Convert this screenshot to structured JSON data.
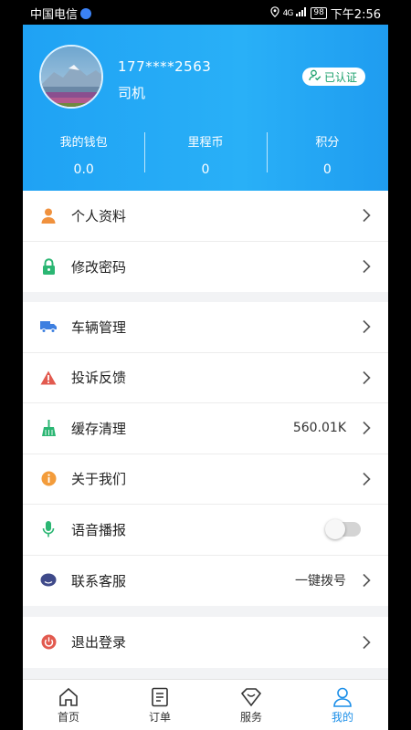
{
  "status_bar": {
    "carrier": "中国电信",
    "signal": "4G",
    "battery": "98",
    "time": "下午2:56"
  },
  "profile": {
    "phone": "177****2563",
    "role": "司机",
    "verified_label": "已认证"
  },
  "stats": [
    {
      "label": "我的钱包",
      "value": "0.0"
    },
    {
      "label": "里程币",
      "value": "0"
    },
    {
      "label": "积分",
      "value": "0"
    }
  ],
  "menu": {
    "group1": [
      {
        "label": "个人资料",
        "icon": "person-icon"
      },
      {
        "label": "修改密码",
        "icon": "lock-icon"
      }
    ],
    "group2": [
      {
        "label": "车辆管理",
        "icon": "truck-icon"
      },
      {
        "label": "投诉反馈",
        "icon": "warning-icon"
      },
      {
        "label": "缓存清理",
        "icon": "broom-icon",
        "value": "560.01K"
      },
      {
        "label": "关于我们",
        "icon": "info-icon"
      },
      {
        "label": "语音播报",
        "icon": "microphone-icon",
        "toggle_on": false
      },
      {
        "label": "联系客服",
        "icon": "chat-icon",
        "value": "一键拨号"
      }
    ],
    "group3": [
      {
        "label": "退出登录",
        "icon": "power-icon"
      }
    ]
  },
  "tabs": [
    {
      "label": "首页",
      "icon": "home-icon",
      "active": false
    },
    {
      "label": "订单",
      "icon": "document-icon",
      "active": false
    },
    {
      "label": "服务",
      "icon": "heart-diamond-icon",
      "active": false
    },
    {
      "label": "我的",
      "icon": "user-icon",
      "active": true
    }
  ],
  "colors": {
    "header_blue": "#1fa2f4",
    "verified_green": "#1aa06b",
    "tab_active": "#1a8ee8",
    "background": "#f2f3f5"
  }
}
